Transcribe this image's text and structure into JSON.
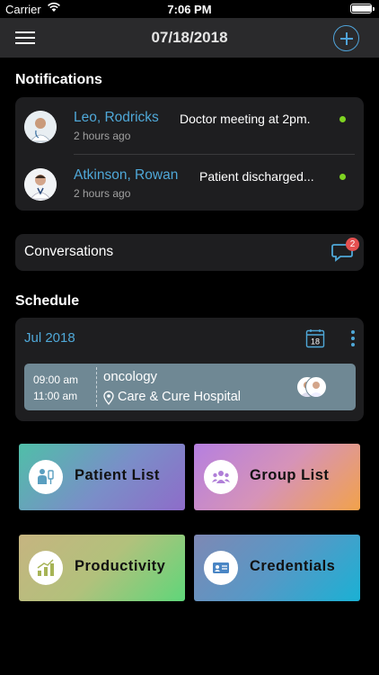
{
  "status_bar": {
    "carrier": "Carrier",
    "time": "7:06 PM",
    "battery_level": 1.0
  },
  "nav": {
    "title": "07/18/2018"
  },
  "notifications": {
    "title": "Notifications",
    "items": [
      {
        "name": "Leo, Rodricks",
        "message": "Doctor meeting at 2pm.",
        "ago": "2 hours ago",
        "unread": true
      },
      {
        "name": "Atkinson, Rowan",
        "message": "Patient discharged...",
        "ago": "2 hours ago",
        "unread": true
      }
    ]
  },
  "conversations": {
    "label": "Conversations",
    "badge": "2"
  },
  "schedule": {
    "title": "Schedule",
    "month": "Jul 2018",
    "calendar_day": "18",
    "event": {
      "start": "09:00 am",
      "end": "11:00 am",
      "title": "oncology",
      "location": "Care & Cure Hospital"
    }
  },
  "tiles": {
    "patients": "Patient List",
    "groups": "Group List",
    "productivity": "Productivity",
    "credentials": "Credentials"
  },
  "colors": {
    "accent": "#4fa8d8",
    "unread_dot": "#7ed321",
    "badge": "#e55050",
    "card": "#1e1e20",
    "event": "#6f8894"
  }
}
